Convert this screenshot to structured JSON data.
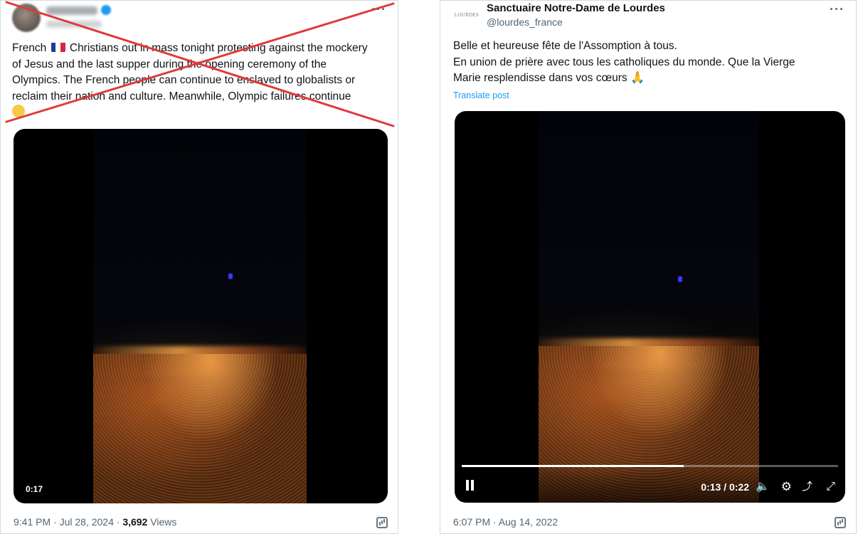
{
  "left_post": {
    "tweet_lines": [
      [
        "French ",
        " Christians out in mass tonight protesting against the mockery"
      ],
      "of Jesus and the last supper during the opening ceremony of the",
      "Olympics. The French people can continue to enslaved to globalists or",
      "reclaim their nation and culture. Meanwhile, Olympic failures continue"
    ],
    "video_time": "0:17",
    "timestamp": "9:41 PM · Jul 28, 2024 · ",
    "views_count": "3,692",
    "views_label": " Views",
    "cross_color": "#e03a3a",
    "more_icon": "more-icon"
  },
  "right_post": {
    "author_name": "Sanctuaire Notre-Dame de Lourdes",
    "author_handle": "@lourdes_france",
    "logo_text": "LOURDES",
    "tweet_lines": [
      "Belle et heureuse fête de l'Assomption à tous.",
      "En union de prière avec tous les catholiques du monde. Que la Vierge",
      "Marie resplendisse dans vos cœurs"
    ],
    "translate_label": "Translate post",
    "video_timecode": "0:13 / 0:22",
    "video_progress": 0.59,
    "timestamp": "6:07 PM · Aug 14, 2022"
  },
  "colors": {
    "link_blue": "#1d9bf0",
    "muted_text": "#536471"
  }
}
